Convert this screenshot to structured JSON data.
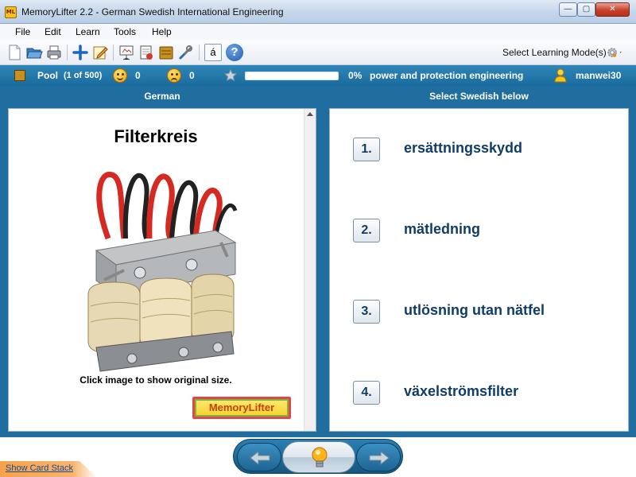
{
  "window": {
    "app_icon": "ML",
    "title": "MemoryLifter 2.2 - German Swedish International Engineering",
    "minimize": "—",
    "maximize": "▢",
    "close": "✕"
  },
  "menu": [
    "File",
    "Edit",
    "Learn",
    "Tools",
    "Help"
  ],
  "toolbar": {
    "icons": [
      "new-document-icon",
      "open-folder-icon",
      "print-icon",
      "add-icon",
      "edit-icon",
      "slideshow-icon",
      "card-view-icon",
      "box-icon",
      "tools-icon",
      "accent-icon",
      "help-icon"
    ],
    "accent_char": "á",
    "help_char": "?",
    "learning_mode_label": "Select Learning Mode(s)"
  },
  "status": {
    "pool_label": "Pool",
    "pool_count": "(1 of 500)",
    "correct_count": "0",
    "wrong_count": "0",
    "progress_fraction": 0.0,
    "progress_text": "0%",
    "category": "power and protection engineering",
    "username": "manwei30"
  },
  "question": {
    "column_header": "German",
    "word": "Filterkreis",
    "image_caption": "Click image to show original size.",
    "logo_text": "MemoryLifter"
  },
  "answers": {
    "column_header": "Select Swedish below",
    "options": [
      {
        "number": "1.",
        "text": "ersättningsskydd"
      },
      {
        "number": "2.",
        "text": "mätledning"
      },
      {
        "number": "3.",
        "text": "utlösning utan nätfel"
      },
      {
        "number": "4.",
        "text": "växelströmsfilter"
      }
    ]
  },
  "footer": {
    "show_card_stack": "Show Card Stack"
  },
  "colors": {
    "status_bar": "#1b6c9e",
    "answer_text": "#0f3d66",
    "progress_fill": "#7fc04a",
    "close_button": "#c8412b",
    "card_stack_tab": "#f6a24b"
  }
}
